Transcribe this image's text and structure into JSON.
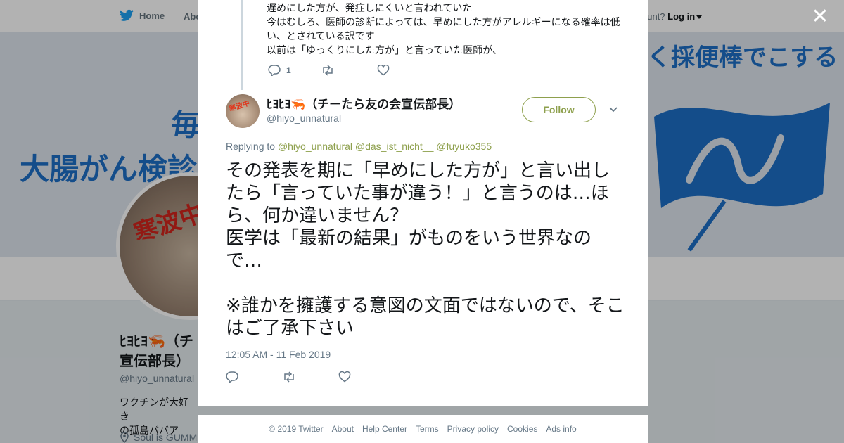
{
  "nav": {
    "home": "Home",
    "about": "Abo",
    "account_prompt": "ccount?",
    "login": "Log in"
  },
  "banner": {
    "left_line1": "毎",
    "left_line2": "大腸がん検診",
    "right_text": "く採便棒でこする",
    "avatar_stamp": "寒波中"
  },
  "profile": {
    "name": "ﾋﾖﾋﾖ🦐（チ\n宣伝部長）",
    "handle": "@hiyo_unnatural",
    "bio": "ワクチンが大好き\nの孤島ババア",
    "location": "Soul is GUMM"
  },
  "previous_tweet": {
    "text": "遅めにした方が、発症しにくいと言われていた\n今はむしろ、医師の診断によっては、早めにした方がアレルギーになる確率は低い、とされている訳です\n以前は「ゆっくりにした方が」と言っていた医師が、",
    "reply_count": "1"
  },
  "tweet": {
    "display_name": "ﾋﾖﾋﾖ🦐（チーたら友の会宣伝部長）",
    "handle": "@hiyo_unnatural",
    "follow_label": "Follow",
    "replying_prefix": "Replying to",
    "mentions": [
      "@hiyo_unnatural",
      "@das_ist_nicht__",
      "@fuyuko355"
    ],
    "text": "その発表を期に「早めにした方が」と言い出したら「言っていた事が違う！」と言うのは…ほら、何か違いません？\n医学は「最新の結果」がものをいう世界なので…\n\n※誰かを擁護する意図の文面ではないので、そこはご了承下さい",
    "timestamp": "12:05 AM - 11 Feb 2019",
    "avatar_stamp": "寒波中"
  },
  "footer": {
    "copyright": "© 2019 Twitter",
    "links": [
      "About",
      "Help Center",
      "Terms",
      "Privacy policy",
      "Cookies",
      "Ads info"
    ]
  },
  "colors": {
    "accent": "#8ea04d",
    "secondary_text": "#657786",
    "twitter_blue": "#1da1f2"
  }
}
